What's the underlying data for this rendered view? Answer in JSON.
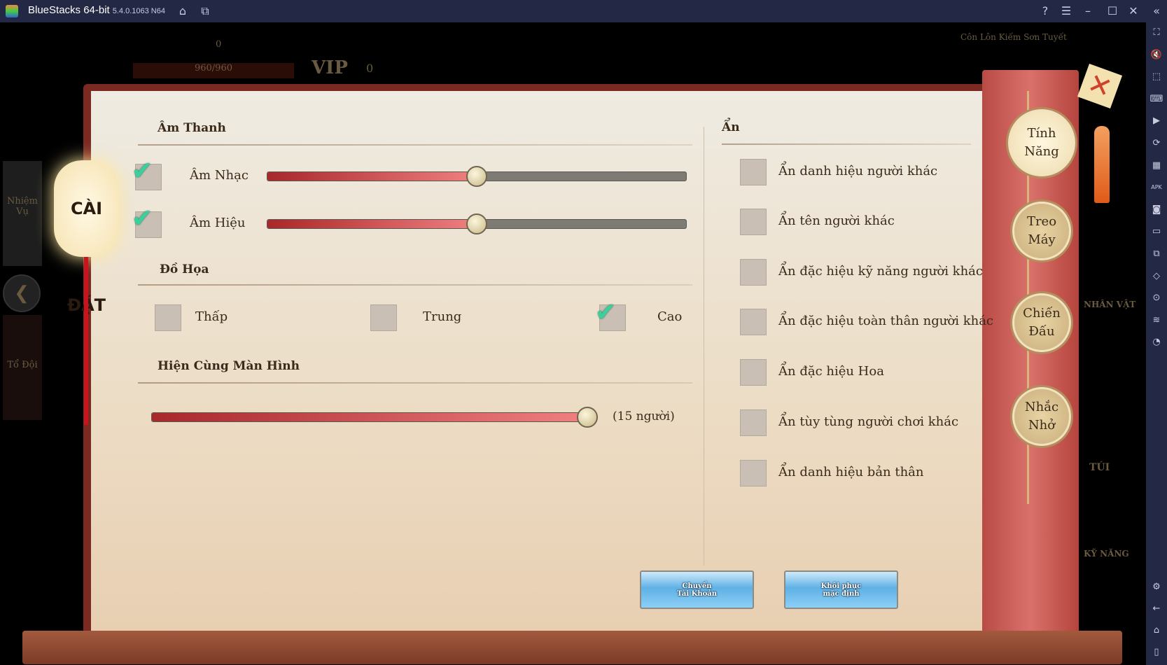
{
  "window": {
    "title": "BlueStacks 64-bit",
    "version": "5.4.0.1063 N64"
  },
  "titlebar_icons": [
    "home-icon",
    "multi-instance-icon",
    "help-icon",
    "menu-icon",
    "minimize-icon",
    "maximize-icon",
    "close-icon",
    "collapse-sidebar-icon"
  ],
  "sidebar_icons": [
    {
      "name": "fullscreen-icon",
      "glyph": "⛶"
    },
    {
      "name": "volume-mute-icon",
      "glyph": "🔇"
    },
    {
      "name": "cursor-icon",
      "glyph": "⬚"
    },
    {
      "name": "keyboard-icon",
      "glyph": "⌨"
    },
    {
      "name": "macro-record-icon",
      "glyph": "▶"
    },
    {
      "name": "rotate-icon",
      "glyph": "⟳"
    },
    {
      "name": "performance-icon",
      "glyph": "▦"
    },
    {
      "name": "install-apk-icon",
      "glyph": "APK"
    },
    {
      "name": "screenshot-icon",
      "glyph": "◙"
    },
    {
      "name": "folder-icon",
      "glyph": "▭"
    },
    {
      "name": "multi-window-icon",
      "glyph": "⧉"
    },
    {
      "name": "eco-mode-icon",
      "glyph": "◇"
    },
    {
      "name": "location-icon",
      "glyph": "⊙"
    },
    {
      "name": "layers-icon",
      "glyph": "≋"
    },
    {
      "name": "speed-icon",
      "glyph": "◔"
    }
  ],
  "sidebar_bottom_icons": [
    {
      "name": "settings-icon",
      "glyph": "⚙"
    },
    {
      "name": "back-icon",
      "glyph": "←"
    },
    {
      "name": "home-icon",
      "glyph": "⌂"
    },
    {
      "name": "recent-apps-icon",
      "glyph": "▯"
    }
  ],
  "game_bg": {
    "gold": "0",
    "hp": "960/960",
    "vip": "VIP",
    "vip_level": "0",
    "server": "Côn Lôn Kiếm Sơn Tuyết",
    "left_tabs": [
      "Nhiệm Vụ",
      "Tổ Đội"
    ],
    "right_items": [
      "NHÂN VẬT",
      "TÚI",
      "KỸ NĂNG"
    ]
  },
  "dialog": {
    "title": "CÀI ĐẶT",
    "sound": {
      "header": "Âm Thanh",
      "rows": [
        {
          "label": "Âm Nhạc",
          "checked": true,
          "level": 0.5
        },
        {
          "label": "Âm Hiệu",
          "checked": true,
          "level": 0.5
        }
      ]
    },
    "graphics": {
      "header": "Đồ Họa",
      "options": [
        {
          "label": "Thấp",
          "checked": false
        },
        {
          "label": "Trung",
          "checked": false
        },
        {
          "label": "Cao",
          "checked": true
        }
      ]
    },
    "display": {
      "header": "Hiện Cùng Màn Hình",
      "value": 15,
      "max": 15,
      "value_label": "(15 người)"
    },
    "hide": {
      "header": "Ẩn",
      "items": [
        {
          "label": "Ẩn danh hiệu người khác",
          "checked": false
        },
        {
          "label": "Ẩn tên người khác",
          "checked": false
        },
        {
          "label": "Ẩn đặc hiệu kỹ năng người khác",
          "checked": false
        },
        {
          "label": "Ẩn đặc hiệu toàn thân người khác",
          "checked": false
        },
        {
          "label": "Ẩn đặc hiệu Hoa",
          "checked": false
        },
        {
          "label": "Ẩn tùy tùng người chơi khác",
          "checked": false
        },
        {
          "label": "Ẩn danh hiệu bản thân",
          "checked": false
        }
      ]
    },
    "buttons": [
      {
        "line1": "Chuyển",
        "line2": "Tài Khoản"
      },
      {
        "line1": "Khôi phục",
        "line2": "mặc định"
      }
    ],
    "tabs": [
      {
        "line1": "Tính",
        "line2": "Năng",
        "active": true
      },
      {
        "line1": "Treo",
        "line2": "Máy",
        "active": false
      },
      {
        "line1": "Chiến",
        "line2": "Đấu",
        "active": false
      },
      {
        "line1": "Nhắc",
        "line2": "Nhở",
        "active": false
      }
    ]
  },
  "colors": {
    "titlebar": "#232845",
    "slider_fill": "#e06060",
    "check": "#3ccf9c",
    "ribbon": "#c85a53"
  }
}
